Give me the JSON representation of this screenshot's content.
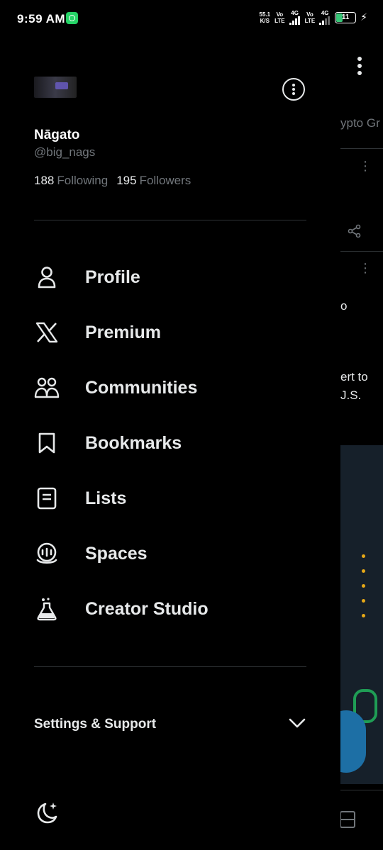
{
  "status_bar": {
    "time": "9:59 AM",
    "net_speed": "55.1",
    "net_unit": "K/S",
    "sim1_type": "Vo",
    "sim1_net": "LTE",
    "sim1_gen": "4G",
    "sim2_type": "Vo",
    "sim2_net": "LTE",
    "sim2_gen": "4G",
    "battery": "11"
  },
  "profile": {
    "display_name": "Nāgato",
    "handle": "@big_nags",
    "following_count": "188",
    "following_label": "Following",
    "followers_count": "195",
    "followers_label": "Followers"
  },
  "menu": [
    {
      "label": "Profile",
      "icon": "person-icon"
    },
    {
      "label": "Premium",
      "icon": "x-logo-icon"
    },
    {
      "label": "Communities",
      "icon": "communities-icon"
    },
    {
      "label": "Bookmarks",
      "icon": "bookmark-icon"
    },
    {
      "label": "Lists",
      "icon": "list-icon"
    },
    {
      "label": "Spaces",
      "icon": "spaces-icon"
    },
    {
      "label": "Creator Studio",
      "icon": "flask-icon"
    }
  ],
  "settings_support": {
    "label": "Settings & Support",
    "icon": "chevron-down-icon"
  },
  "bottom": {
    "icon": "moon-icon"
  },
  "background_peek": {
    "text_1": "ypto Gr",
    "text_2": "o",
    "text_3": "ert to",
    "text_4": "J.S."
  },
  "colors": {
    "background": "#000000",
    "text_primary": "#e7e9ea",
    "text_secondary": "#71767b",
    "divider": "#2f3336"
  }
}
